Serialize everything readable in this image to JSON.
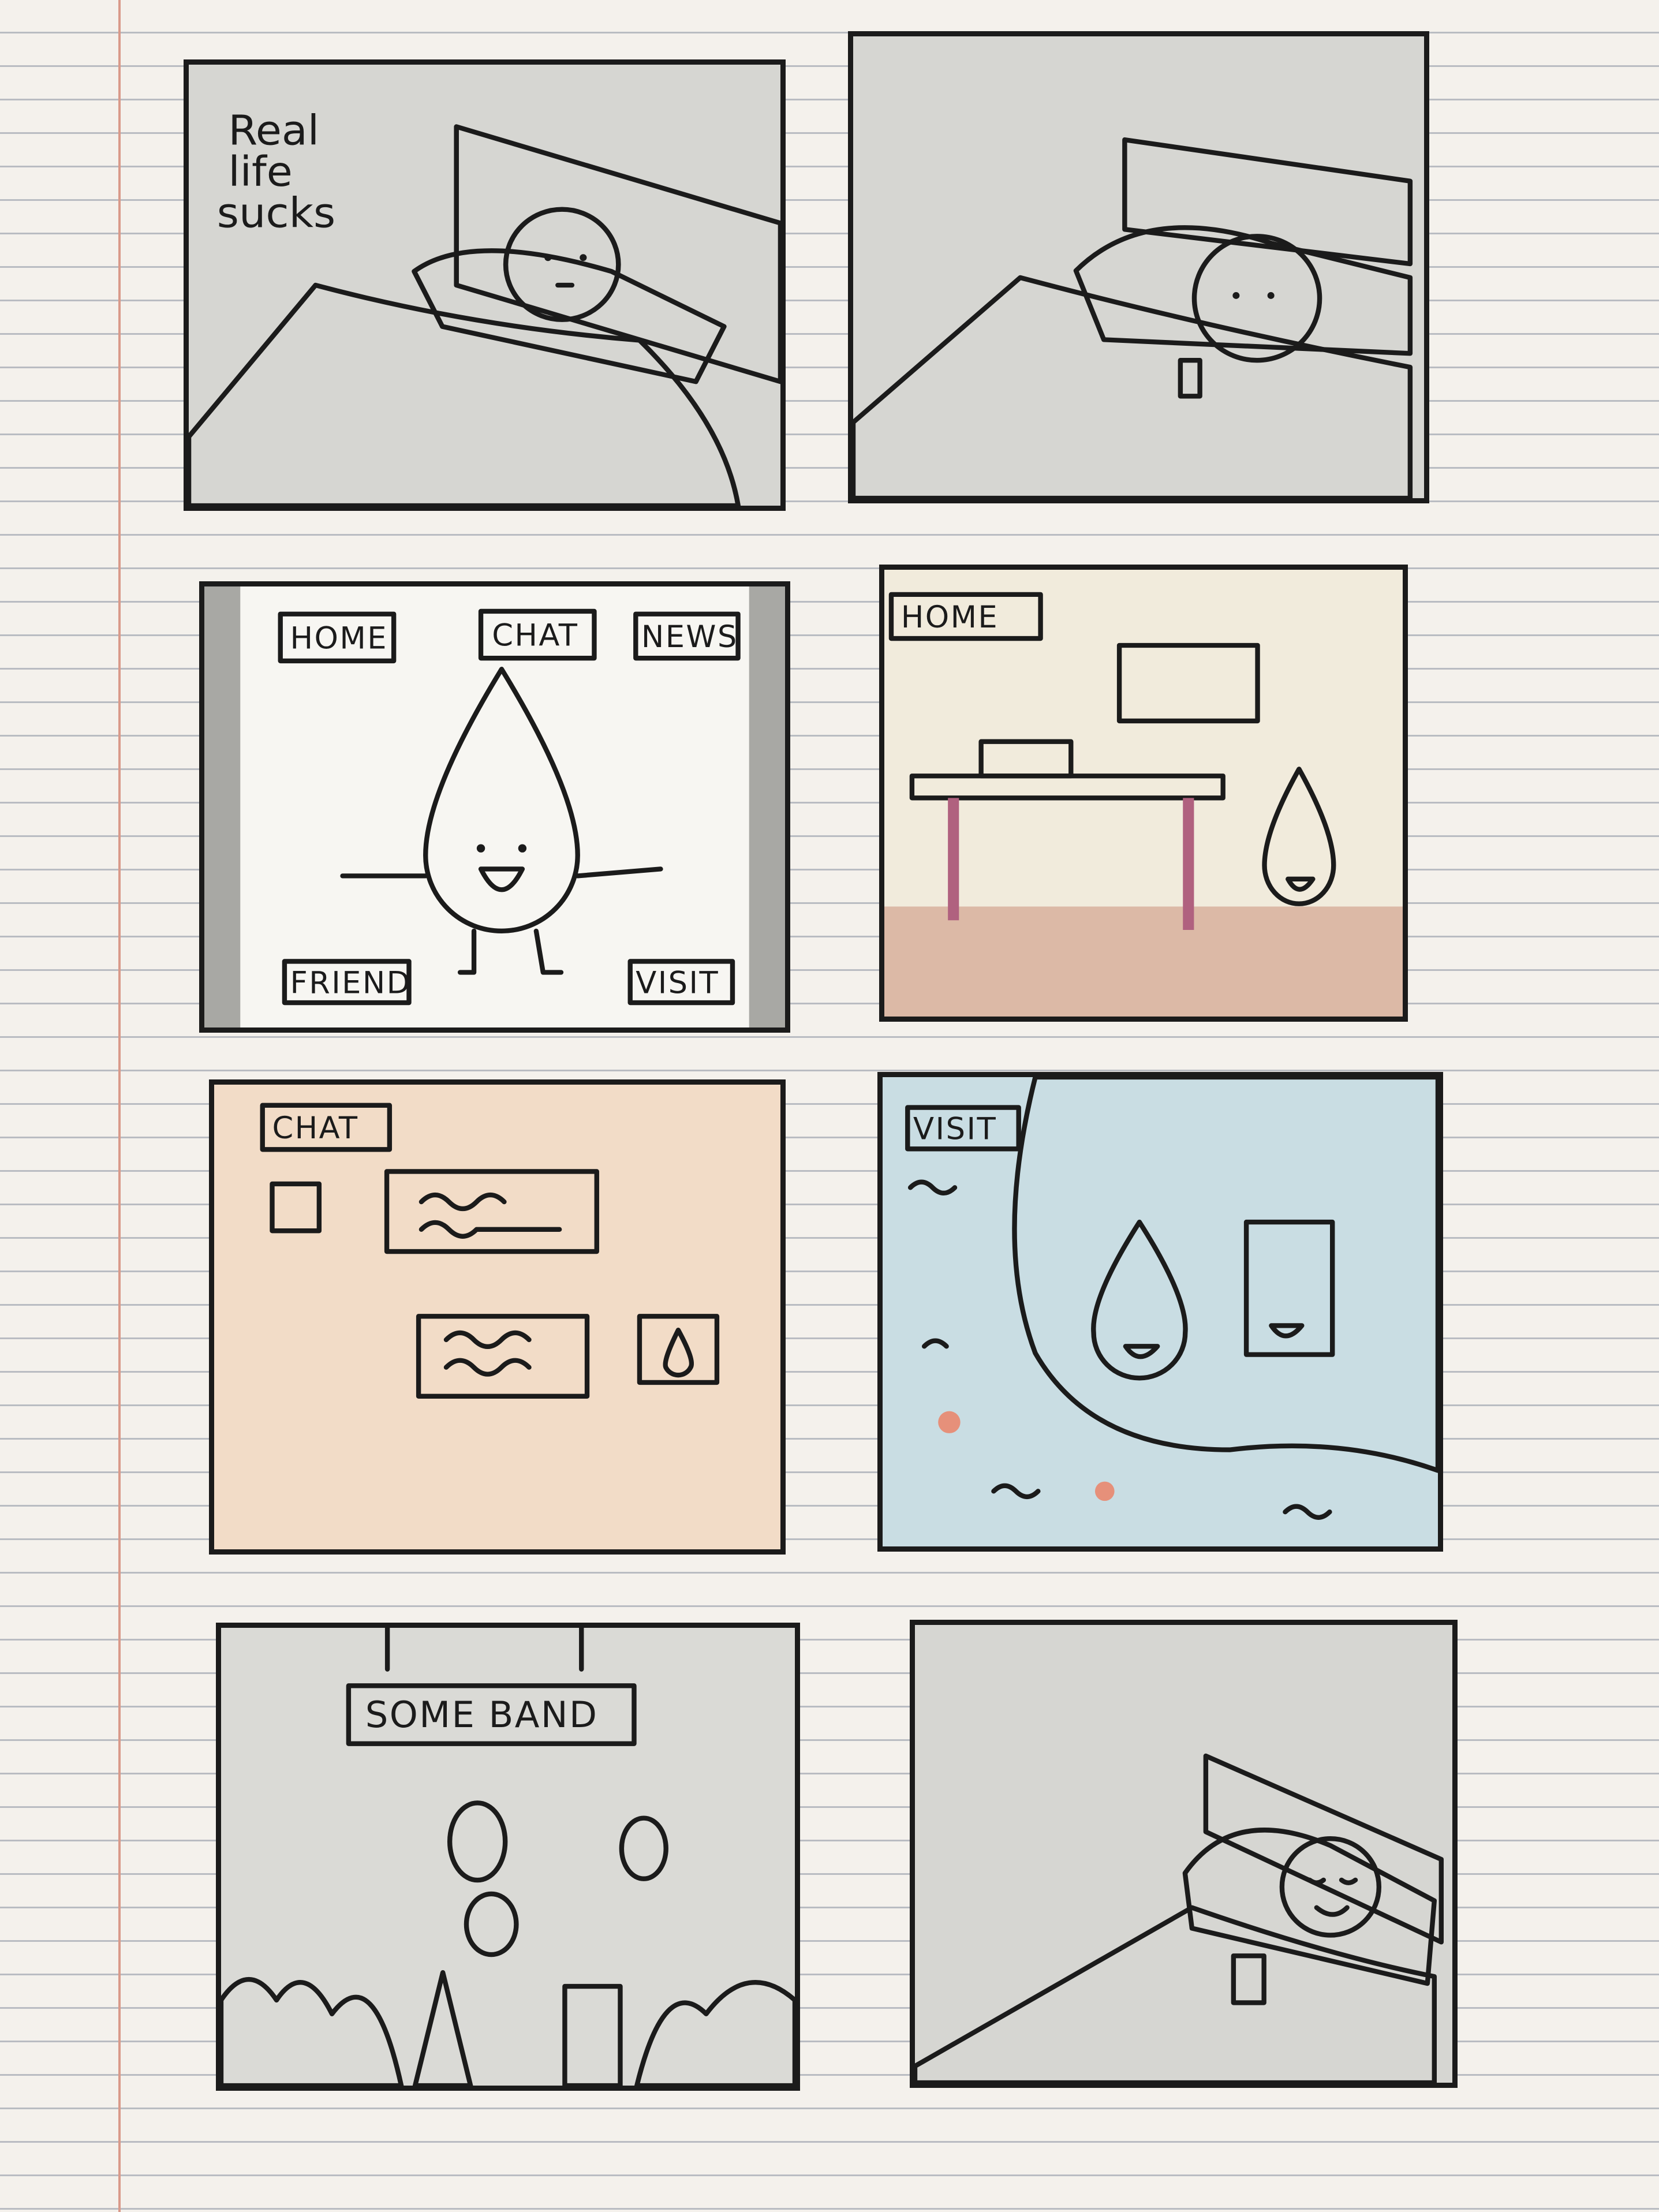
{
  "panels": [
    {
      "id": 1,
      "caption": [
        "Real",
        "life",
        "sucks"
      ]
    },
    {
      "id": 2
    },
    {
      "id": 3,
      "buttons": {
        "home": "HOME",
        "chat": "CHAT",
        "news": "NEWS",
        "friend": "FRIEND",
        "visit": "VISIT"
      }
    },
    {
      "id": 4,
      "label": "HOME"
    },
    {
      "id": 5,
      "label": "CHAT"
    },
    {
      "id": 6,
      "label": "VISIT"
    },
    {
      "id": 7,
      "sign": "SOME BAND"
    },
    {
      "id": 8
    }
  ],
  "colors": {
    "blanket": "#b9d3e4",
    "headboard": "#c98e72",
    "drop": "#8f9fcc",
    "sand": "#f3d3b0",
    "water": "#c9dde3",
    "green": "#c9dc95"
  }
}
